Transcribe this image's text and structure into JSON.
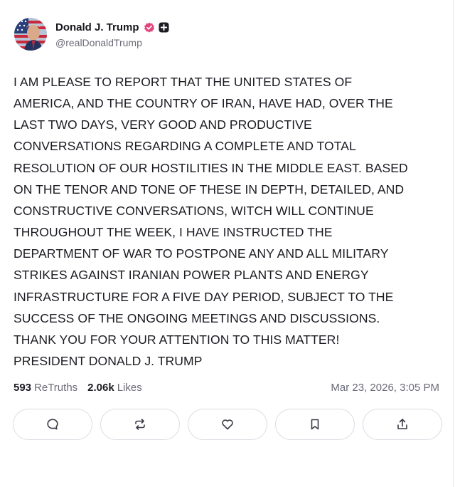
{
  "author": {
    "display_name": "Donald J. Trump",
    "handle": "@realDonaldTrump",
    "avatar_icon": "flag-portrait-avatar",
    "verified_color": "#e0457b"
  },
  "post": {
    "text": "I AM PLEASE TO REPORT THAT THE UNITED STATES OF\nAMERICA, AND THE COUNTRY OF IRAN, HAVE HAD, OVER THE\nLAST TWO DAYS, VERY GOOD AND PRODUCTIVE\nCONVERSATIONS REGARDING A COMPLETE AND TOTAL\nRESOLUTION OF OUR HOSTILITIES IN THE MIDDLE EAST. BASED\nON THE TENOR AND TONE OF THESE IN DEPTH, DETAILED, AND\nCONSTRUCTIVE CONVERSATIONS, WITCH WILL CONTINUE\nTHROUGHOUT THE WEEK, I HAVE INSTRUCTED THE\nDEPARTMENT OF WAR TO POSTPONE ANY AND ALL MILITARY\nSTRIKES AGAINST IRANIAN POWER PLANTS AND ENERGY\nINFRASTRUCTURE FOR A FIVE DAY PERIOD, SUBJECT TO THE\nSUCCESS OF THE ONGOING MEETINGS AND DISCUSSIONS.\nTHANK YOU FOR YOUR ATTENTION TO THIS MATTER!\nPRESIDENT DONALD J. TRUMP",
    "retruths_count": "593",
    "retruths_label": "ReTruths",
    "likes_count": "2.06k",
    "likes_label": "Likes",
    "timestamp": "Mar 23, 2026, 3:05 PM"
  },
  "actions": [
    {
      "name": "reply",
      "icon": "reply-icon"
    },
    {
      "name": "retruth",
      "icon": "retruth-icon"
    },
    {
      "name": "like",
      "icon": "heart-icon"
    },
    {
      "name": "bookmark",
      "icon": "bookmark-icon"
    },
    {
      "name": "share",
      "icon": "share-icon"
    }
  ]
}
